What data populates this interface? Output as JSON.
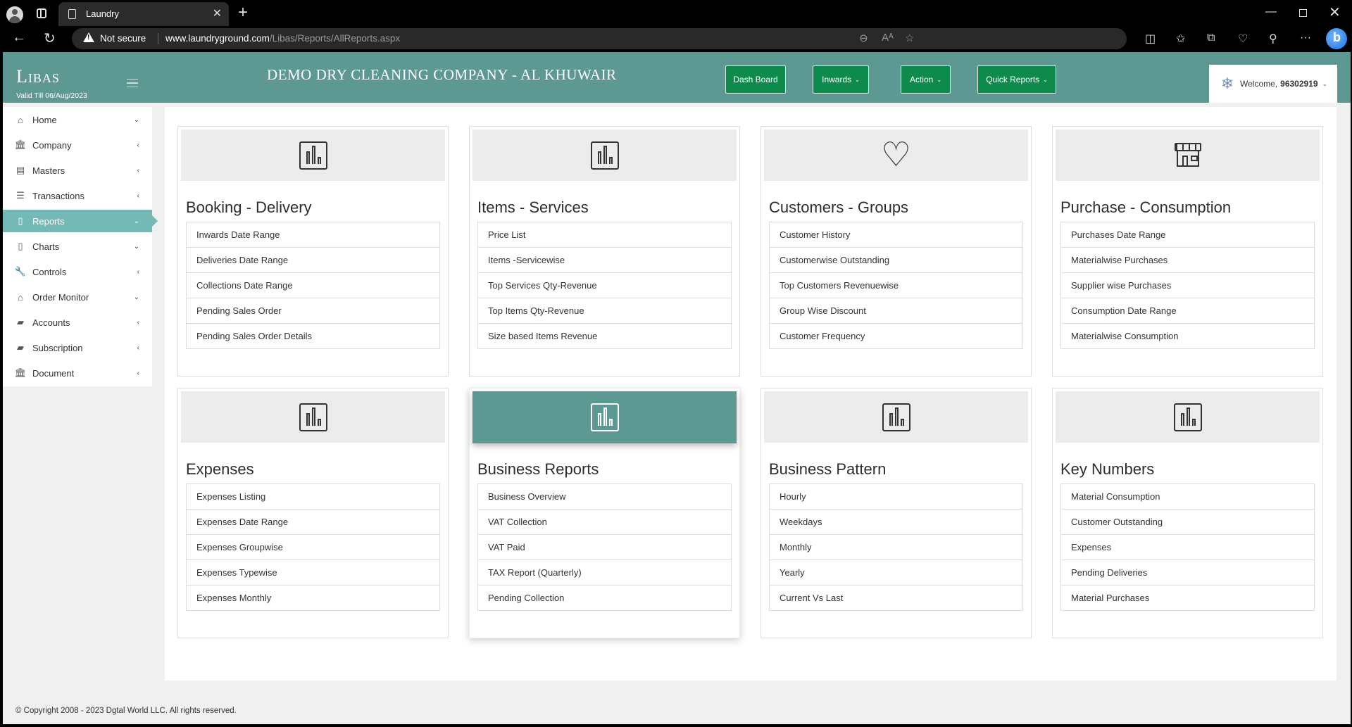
{
  "browser": {
    "tab_title": "Laundry",
    "security_label": "Not secure",
    "url_host": "www.laundryground.com",
    "url_path": "/Libas/Reports/AllReports.aspx"
  },
  "header": {
    "logo": "Libas",
    "valid_till": "Valid Till 06/Aug/2023",
    "company": "DEMO DRY CLEANING COMPANY - AL KHUWAIR",
    "buttons": [
      {
        "label": "Dash Board"
      },
      {
        "label": "Inwards"
      },
      {
        "label": "Action"
      },
      {
        "label": "Quick Reports"
      }
    ],
    "welcome_prefix": "Welcome,",
    "username": "96302919"
  },
  "sidebar": {
    "items": [
      {
        "label": "Home",
        "icon": "home-icon",
        "arrow": "chevron-down",
        "active": false
      },
      {
        "label": "Company",
        "icon": "bank-icon",
        "arrow": "chevron-left",
        "active": false
      },
      {
        "label": "Masters",
        "icon": "book-icon",
        "arrow": "chevron-left",
        "active": false
      },
      {
        "label": "Transactions",
        "icon": "list-icon",
        "arrow": "chevron-left",
        "active": false
      },
      {
        "label": "Reports",
        "icon": "document-icon",
        "arrow": "chevron-down",
        "active": true
      },
      {
        "label": "Charts",
        "icon": "document-icon",
        "arrow": "chevron-down",
        "active": false
      },
      {
        "label": "Controls",
        "icon": "wrench-icon",
        "arrow": "chevron-left",
        "active": false
      },
      {
        "label": "Order Monitor",
        "icon": "home-icon",
        "arrow": "chevron-down",
        "active": false
      },
      {
        "label": "Accounts",
        "icon": "book-icon",
        "arrow": "chevron-left",
        "active": false
      },
      {
        "label": "Subscription",
        "icon": "book-icon",
        "arrow": "chevron-left",
        "active": false
      },
      {
        "label": "Document",
        "icon": "bank-icon",
        "arrow": "chevron-left",
        "active": false
      }
    ]
  },
  "cards": [
    {
      "title": "Booking - Delivery",
      "icon": "bar-chart-icon",
      "links": [
        "Inwards Date Range",
        "Deliveries Date Range",
        "Collections Date Range",
        "Pending Sales Order",
        "Pending Sales Order Details"
      ]
    },
    {
      "title": "Items - Services",
      "icon": "bar-chart-icon",
      "links": [
        "Price List",
        "Items -Servicewise",
        "Top Services Qty-Revenue",
        "Top Items Qty-Revenue",
        "Size based Items Revenue"
      ]
    },
    {
      "title": "Customers - Groups",
      "icon": "heart-icon",
      "links": [
        "Customer History",
        "Customerwise Outstanding",
        "Top Customers Revenuewise",
        "Group Wise Discount",
        "Customer Frequency"
      ]
    },
    {
      "title": "Purchase - Consumption",
      "icon": "store-icon",
      "links": [
        "Purchases Date Range",
        "Materialwise Purchases",
        "Supplier wise Purchases",
        "Consumption Date Range",
        "Materialwise Consumption"
      ]
    },
    {
      "title": "Expenses",
      "icon": "bar-chart-icon",
      "links": [
        "Expenses Listing",
        "Expenses Date Range",
        "Expenses Groupwise",
        "Expenses Typewise",
        "Expenses Monthly"
      ]
    },
    {
      "title": "Business Reports",
      "icon": "bar-chart-icon",
      "highlighted": true,
      "links": [
        "Business Overview",
        "VAT Collection",
        "VAT Paid",
        "TAX Report (Quarterly)",
        "Pending Collection"
      ]
    },
    {
      "title": "Business Pattern",
      "icon": "bar-chart-icon",
      "links": [
        "Hourly",
        "Weekdays",
        "Monthly",
        "Yearly",
        "Current Vs Last"
      ]
    },
    {
      "title": "Key Numbers",
      "icon": "bar-chart-icon",
      "links": [
        "Material Consumption",
        "Customer Outstanding",
        "Expenses",
        "Pending Deliveries",
        "Material Purchases"
      ]
    }
  ],
  "footer": {
    "copyright": "© Copyright 2008 - 2023 Dgtal World LLC. All rights reserved."
  },
  "colors": {
    "header_teal": "#5d9893",
    "sidebar_active": "#75b9b7",
    "button_green": "#0f8a4d"
  }
}
